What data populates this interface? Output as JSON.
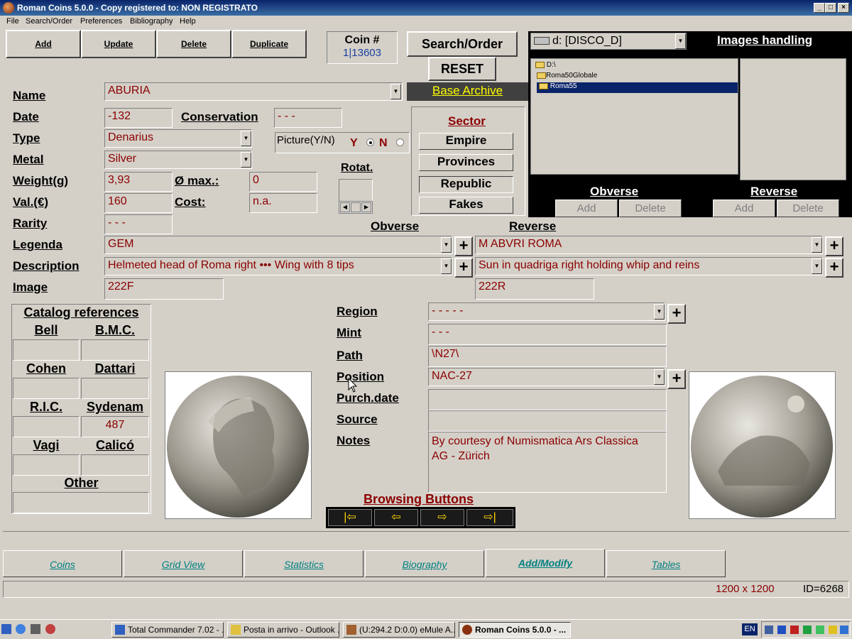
{
  "window": {
    "title": "Roman Coins 5.0.0 - Copy registered to:  NON REGISTRATO"
  },
  "menu": [
    "File",
    "Search/Order",
    "Preferences",
    "Bibliography",
    "Help"
  ],
  "toolbar": {
    "add": "Add",
    "update": "Update",
    "delete": "Delete",
    "duplicate": "Duplicate",
    "coin_label": "Coin #",
    "coin_value": "1|13603",
    "search_order": "Search/Order",
    "reset": "RESET",
    "base_archive": "Base Archive"
  },
  "fields": {
    "name": {
      "label": "Name",
      "value": "ABURIA"
    },
    "date": {
      "label": "Date",
      "value": "-132"
    },
    "conservation": {
      "label": "Conservation",
      "value": "- - -"
    },
    "type": {
      "label": "Type",
      "value": "Denarius"
    },
    "picture": {
      "label": "Picture(Y/N)",
      "y": "Y",
      "n": "N"
    },
    "metal": {
      "label": "Metal",
      "value": "Silver"
    },
    "weight": {
      "label": "Weight(g)",
      "value": "3,93"
    },
    "diameter": {
      "label": "Ø max.:",
      "value": "0"
    },
    "value": {
      "label": "Val.(€)",
      "value": "160"
    },
    "cost": {
      "label": "Cost:",
      "value": "n.a."
    },
    "rarity": {
      "label": "Rarity",
      "value": "- - -"
    },
    "rotat": {
      "label": "Rotat."
    },
    "obverse_hdr": "Obverse",
    "reverse_hdr": "Reverse",
    "legenda": {
      "label": "Legenda",
      "obverse": "GEM",
      "reverse": "M ABVRI ROMA"
    },
    "description": {
      "label": "Description",
      "obverse": "Helmeted head of Roma right ••• Wing with 8 tips",
      "reverse": "Sun in quadriga right holding whip and reins"
    },
    "image": {
      "label": "Image",
      "obverse": "222F",
      "reverse": "222R"
    },
    "region": {
      "label": "Region",
      "value": "- - - - -"
    },
    "mint": {
      "label": "Mint",
      "value": "- - -"
    },
    "path": {
      "label": "Path",
      "value": "\\N27\\"
    },
    "position": {
      "label": "Position",
      "value": "NAC-27"
    },
    "purch_date": {
      "label": "Purch.date",
      "value": ""
    },
    "source": {
      "label": "Source",
      "value": ""
    },
    "notes": {
      "label": "Notes",
      "line1": "By courtesy of Numismatica Ars Classica",
      "line2": "AG - Zürich"
    }
  },
  "sector": {
    "title": "Sector",
    "items": [
      "Empire",
      "Provinces",
      "Republic",
      "Fakes"
    ]
  },
  "images_panel": {
    "drive": "d: [DISCO_D]",
    "title": "Images handling",
    "folders": [
      "D:\\",
      "Roma50Globale",
      "Roma55"
    ],
    "obverse": "Obverse",
    "reverse": "Reverse",
    "add": "Add",
    "delete": "Delete"
  },
  "catalog": {
    "title": "Catalog references",
    "bell": "Bell",
    "bmc": "B.M.C.",
    "cohen": "Cohen",
    "dattari": "Dattari",
    "ric": "R.I.C.",
    "sydenam": "Sydenam",
    "sydenam_value": "487",
    "vagi": "Vagi",
    "calico": "Calicó",
    "other": "Other"
  },
  "browsing": {
    "title": "Browsing Buttons"
  },
  "tabs": [
    "Coins",
    "Grid View",
    "Statistics",
    "Biography",
    "Add/Modify",
    "Tables"
  ],
  "status": {
    "resolution": "1200 x 1200",
    "id": "ID=6268"
  },
  "taskbar": {
    "items": [
      "Total Commander 7.02 - ...",
      "Posta in arrivo - Outlook ...",
      "(U:294.2 D:0.0) eMule A...",
      "Roman Coins 5.0.0 - ..."
    ],
    "lang": "EN"
  },
  "colors": {
    "field_text": "#8b0000",
    "tab_text": "#008080",
    "title_bar": "#0a246a"
  }
}
